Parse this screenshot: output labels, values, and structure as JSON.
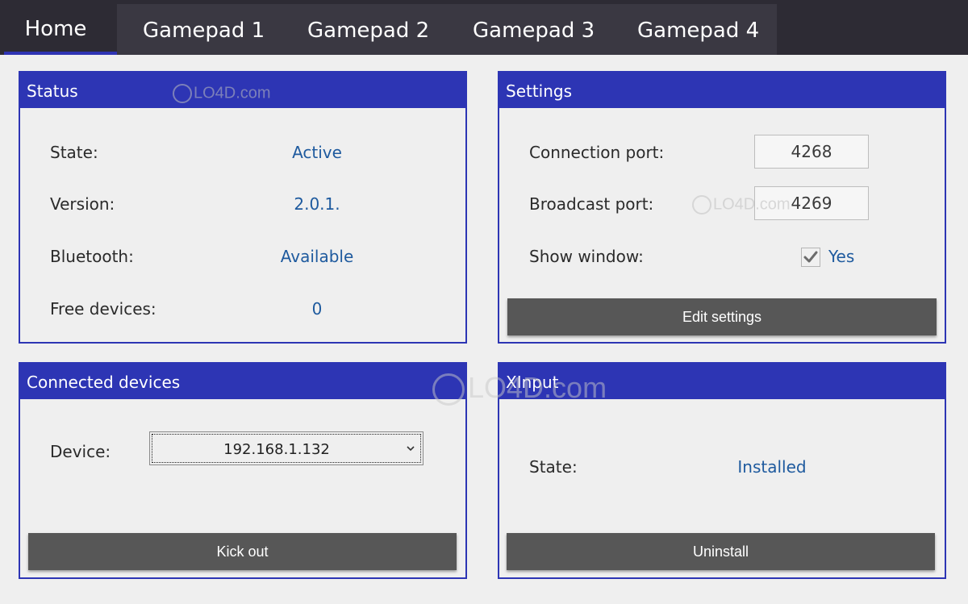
{
  "tabs": [
    {
      "label": "Home",
      "active": true
    },
    {
      "label": "Gamepad 1"
    },
    {
      "label": "Gamepad 2"
    },
    {
      "label": "Gamepad 3"
    },
    {
      "label": "Gamepad 4"
    }
  ],
  "status": {
    "title": "Status",
    "rows": [
      {
        "label": "State:",
        "value": "Active"
      },
      {
        "label": "Version:",
        "value": "2.0.1."
      },
      {
        "label": "Bluetooth:",
        "value": "Available"
      },
      {
        "label": "Free devices:",
        "value": "0"
      }
    ]
  },
  "settings": {
    "title": "Settings",
    "connection_port_label": "Connection port:",
    "connection_port_value": "4268",
    "broadcast_port_label": "Broadcast port:",
    "broadcast_port_value": "4269",
    "show_window_label": "Show window:",
    "show_window_checked": true,
    "show_window_value": "Yes",
    "edit_button": "Edit settings"
  },
  "connected": {
    "title": "Connected devices",
    "device_label": "Device:",
    "device_selected": "192.168.1.132",
    "kick_button": "Kick out"
  },
  "xinput": {
    "title": "XInput",
    "state_label": "State:",
    "state_value": "Installed",
    "uninstall_button": "Uninstall"
  },
  "watermark": {
    "text": "LO4D.com"
  },
  "colors": {
    "accent": "#2d35b4",
    "value_text": "#1e5a9e",
    "button": "#575757",
    "tabbar": "#2d2b34"
  }
}
